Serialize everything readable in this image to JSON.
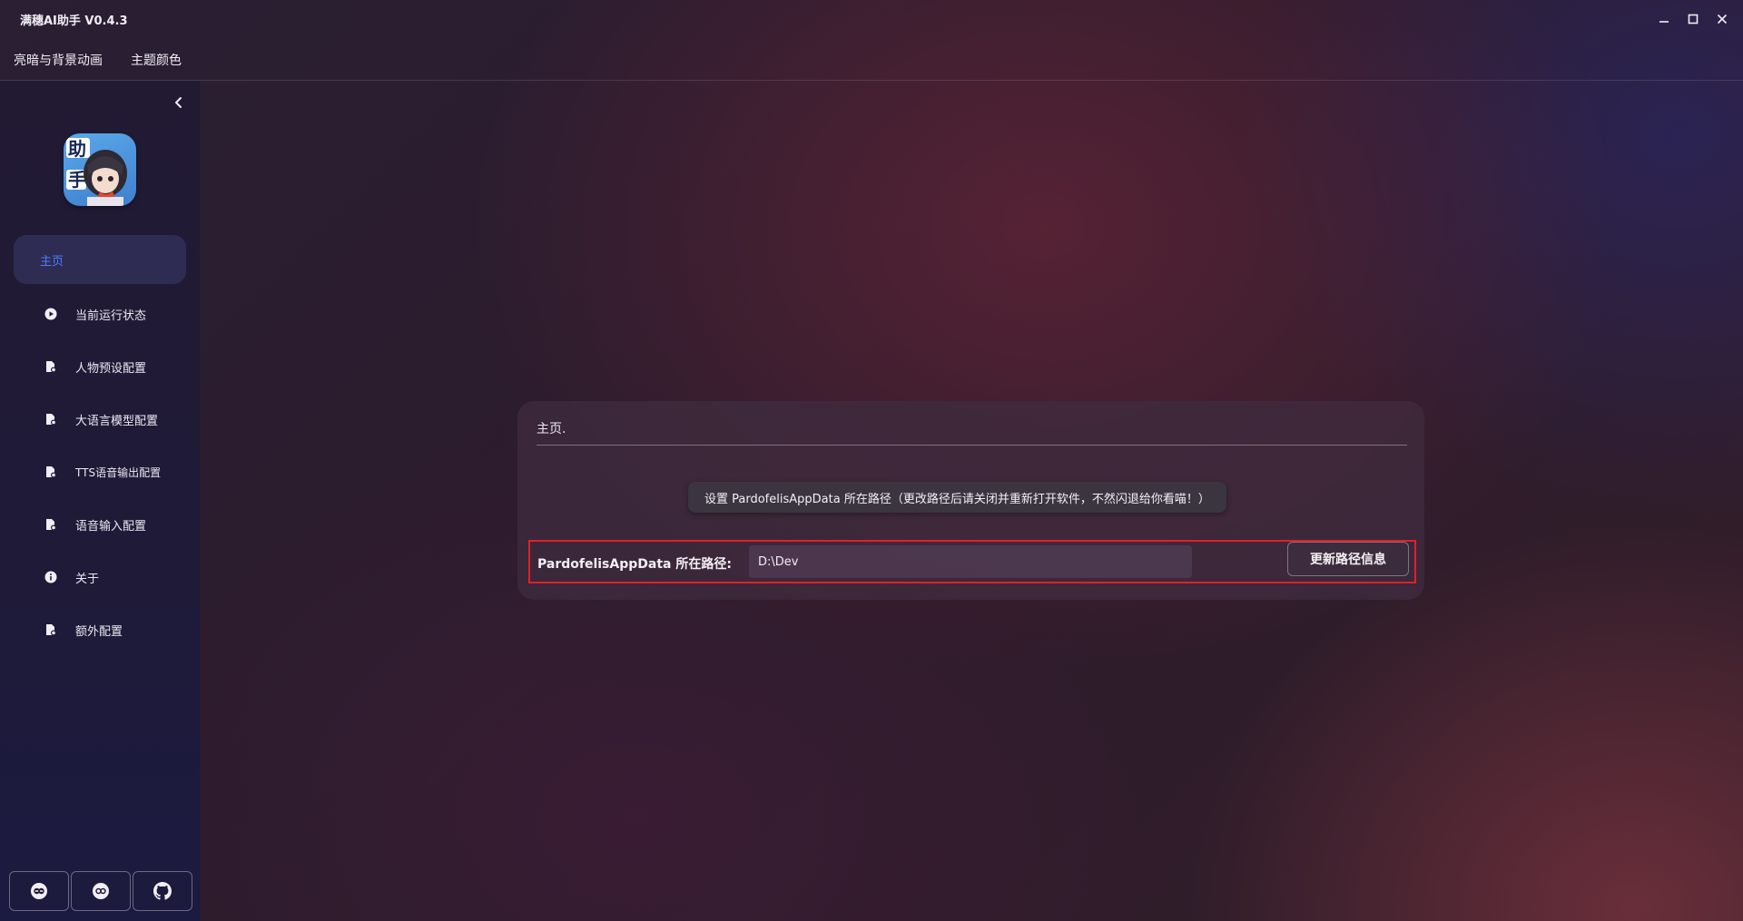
{
  "window": {
    "title": "满穗AI助手 V0.4.3",
    "controls": [
      "minimize-icon",
      "maximize-icon",
      "close-icon"
    ]
  },
  "menubar": {
    "items": [
      "亮暗与背景动画",
      "主题颜色"
    ]
  },
  "sidebar": {
    "items": [
      {
        "label": "主页",
        "icon": "",
        "active": true
      },
      {
        "label": "当前运行状态",
        "icon": "play-circle-icon"
      },
      {
        "label": "人物预设配置",
        "icon": "file-settings-icon"
      },
      {
        "label": "大语言模型配置",
        "icon": "file-settings-icon"
      },
      {
        "label": "TTS语音输出配置",
        "icon": "file-settings-icon"
      },
      {
        "label": "语音输入配置",
        "icon": "file-settings-icon"
      },
      {
        "label": "关于",
        "icon": "info-icon"
      },
      {
        "label": "额外配置",
        "icon": "file-settings-icon"
      }
    ],
    "bottom_buttons": [
      "link-icon",
      "link-icon",
      "github-icon"
    ]
  },
  "main": {
    "card_title": "主页.",
    "tooltip": "设置 PardofelisAppData 所在路径（更改路径后请关闭并重新打开软件，不然闪退给你看喵！）",
    "path_label": "PardofelisAppData 所在路径:",
    "path_value": "D:\\Dev",
    "update_button": "更新路径信息"
  },
  "colors": {
    "accent": "#4a7dff",
    "highlight_border": "#e0202a"
  }
}
